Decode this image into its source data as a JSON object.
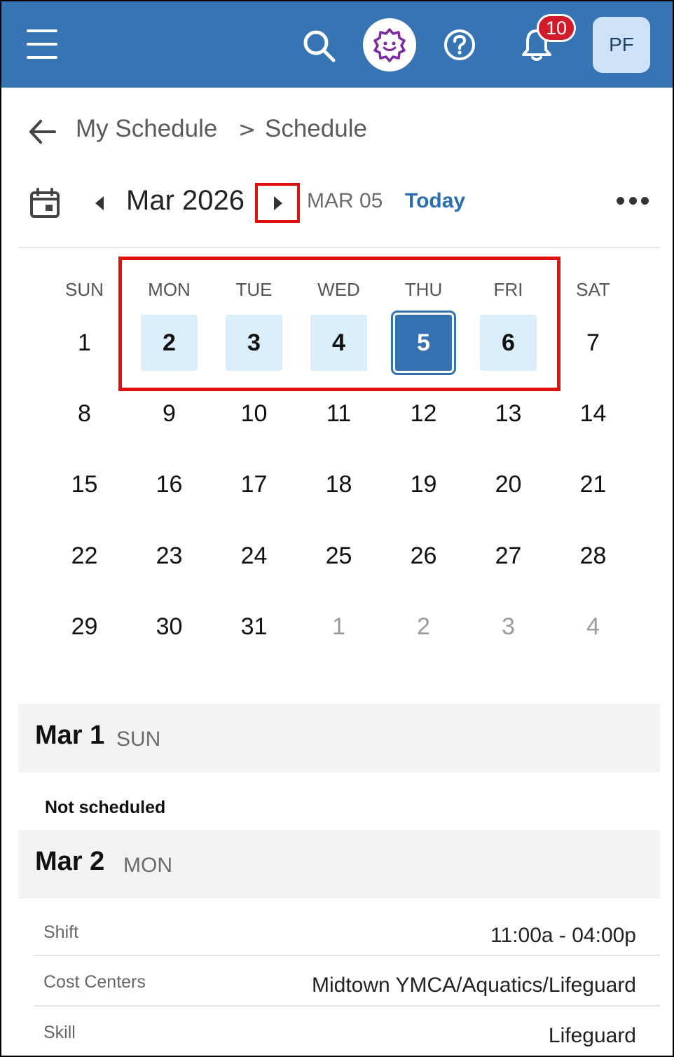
{
  "header": {
    "notification_count": "10",
    "avatar_initials": "PF",
    "bar_color": "#3774b3",
    "icons": [
      "menu-icon",
      "search-icon",
      "ai-assistant-icon",
      "help-icon",
      "bell-icon"
    ]
  },
  "breadcrumb": {
    "parent": "My Schedule",
    "separator": ">",
    "current": "Schedule"
  },
  "calendar": {
    "month_label": "Mar 2026",
    "selected_date_label": "MAR 05",
    "today_label": "Today",
    "weekdays": [
      "SUN",
      "MON",
      "TUE",
      "WED",
      "THU",
      "FRI",
      "SAT"
    ],
    "weeks": [
      [
        "1",
        "2",
        "3",
        "4",
        "5",
        "6",
        "7"
      ],
      [
        "8",
        "9",
        "10",
        "11",
        "12",
        "13",
        "14"
      ],
      [
        "15",
        "16",
        "17",
        "18",
        "19",
        "20",
        "21"
      ],
      [
        "22",
        "23",
        "24",
        "25",
        "26",
        "27",
        "28"
      ],
      [
        "29",
        "30",
        "31",
        "1",
        "2",
        "3",
        "4"
      ]
    ],
    "scheduled_days": [
      "2",
      "3",
      "4",
      "6"
    ],
    "current_day": "5",
    "accent_color": "#3571b0",
    "highlight_color": "#e01010"
  },
  "schedule": {
    "days": [
      {
        "date": "Mar 1",
        "dow": "SUN",
        "status": "Not scheduled"
      },
      {
        "date": "Mar 2",
        "dow": "MON",
        "details": [
          {
            "label": "Shift",
            "value": "11:00a - 04:00p"
          },
          {
            "label": "Cost Centers",
            "value": "Midtown YMCA/Aquatics/Lifeguard"
          },
          {
            "label": "Skill",
            "value": "Lifeguard"
          }
        ]
      }
    ]
  }
}
